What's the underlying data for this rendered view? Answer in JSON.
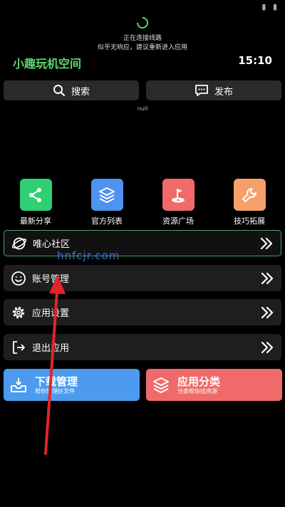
{
  "loading": {
    "line1": "正在连接线路",
    "line2": "似乎无响应，建议重新进入应用"
  },
  "header": {
    "title": "小趣玩机空间",
    "time": "15:10"
  },
  "top_buttons": {
    "search": "搜索",
    "publish": "发布"
  },
  "null_text": "null",
  "grid": [
    {
      "label": "最新分享",
      "color": "#2fcf74",
      "icon": "share-icon"
    },
    {
      "label": "官方列表",
      "color": "#4f92f0",
      "icon": "layers-icon"
    },
    {
      "label": "资源广场",
      "color": "#f06a6a",
      "icon": "golf-flag-icon"
    },
    {
      "label": "技巧拓展",
      "color": "#f5a06a",
      "icon": "wrench-icon"
    }
  ],
  "rows": [
    {
      "label": "唯心社区",
      "icon": "planet-icon"
    },
    {
      "label": "账号管理",
      "icon": "smiley-icon"
    },
    {
      "label": "应用设置",
      "icon": "gear-icon"
    },
    {
      "label": "退出应用",
      "icon": "exit-icon"
    }
  ],
  "cards": {
    "download": {
      "title": "下载管理",
      "subtitle": "帮你管理好文件",
      "color": "#4c9bef"
    },
    "category": {
      "title": "应用分类",
      "subtitle": "分类帮你找资源",
      "color": "#f06a6a"
    }
  },
  "watermark": "hnfcjr.com",
  "colors": {
    "accent_green": "#59d86a",
    "arrow_red": "#e0252a"
  }
}
